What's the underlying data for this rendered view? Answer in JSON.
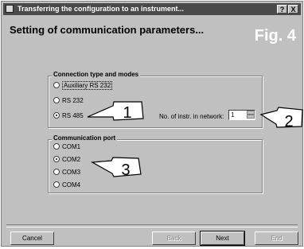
{
  "window": {
    "title": "Transferring the configuration to an instrument...",
    "help_label": "?",
    "close_label": "X"
  },
  "header": {
    "heading": "Setting of communication parameters...",
    "fig_label": "Fig. 4"
  },
  "connection": {
    "group_label": "Connection type and modes",
    "options": [
      {
        "label": "Auxiliary RS 232",
        "checked": false
      },
      {
        "label": "RS 232",
        "checked": false
      },
      {
        "label": "RS 485",
        "checked": true
      }
    ],
    "instr_label": "No. of instr. in network:",
    "instr_value": "1"
  },
  "port": {
    "group_label": "Communication port",
    "options": [
      {
        "label": "COM1",
        "checked": false
      },
      {
        "label": "COM2",
        "checked": true
      },
      {
        "label": "COM3",
        "checked": false
      },
      {
        "label": "COM4",
        "checked": false
      }
    ]
  },
  "callouts": {
    "one": "1",
    "two": "2",
    "three": "3"
  },
  "buttons": {
    "cancel": "Cancel",
    "back": "Back",
    "next": "Next",
    "end": "End"
  }
}
